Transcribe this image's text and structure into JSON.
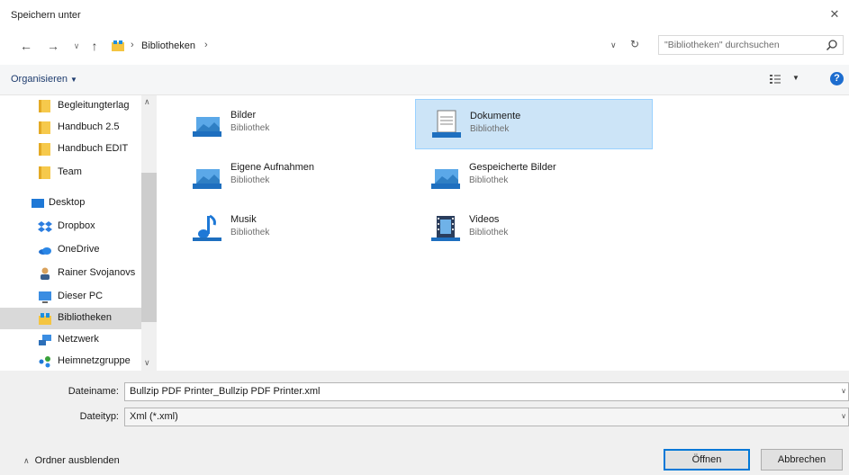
{
  "window": {
    "title": "Speichern unter"
  },
  "nav": {
    "back_icon": "back-arrow-icon",
    "forward_icon": "forward-arrow-icon",
    "up_icon": "up-arrow-icon",
    "address_segment": "Bibliotheken",
    "search_placeholder": "\"Bibliotheken\" durchsuchen"
  },
  "toolbar": {
    "organize_label": "Organisieren"
  },
  "sidebar": {
    "items": [
      {
        "label": "Begleitungterlag",
        "icon": "folder-icon"
      },
      {
        "label": "Handbuch 2.5",
        "icon": "folder-icon"
      },
      {
        "label": "Handbuch EDIT",
        "icon": "folder-icon"
      },
      {
        "label": "Team",
        "icon": "folder-icon"
      },
      {
        "label": "Desktop",
        "icon": "desktop-icon"
      },
      {
        "label": "Dropbox",
        "icon": "dropbox-icon"
      },
      {
        "label": "OneDrive",
        "icon": "onedrive-icon"
      },
      {
        "label": "Rainer Svojanovs",
        "icon": "user-icon"
      },
      {
        "label": "Dieser PC",
        "icon": "computer-icon"
      },
      {
        "label": "Bibliotheken",
        "icon": "libraries-icon",
        "selected": true
      },
      {
        "label": "Netzwerk",
        "icon": "network-icon"
      },
      {
        "label": "Heimnetzgruppe",
        "icon": "homegroup-icon"
      }
    ]
  },
  "libraries": [
    {
      "name": "Bilder",
      "type": "Bibliothek",
      "icon": "pictures-library-icon"
    },
    {
      "name": "Dokumente",
      "type": "Bibliothek",
      "icon": "documents-library-icon",
      "selected": true
    },
    {
      "name": "Eigene Aufnahmen",
      "type": "Bibliothek",
      "icon": "pictures-library-icon"
    },
    {
      "name": "Gespeicherte Bilder",
      "type": "Bibliothek",
      "icon": "pictures-library-icon"
    },
    {
      "name": "Musik",
      "type": "Bibliothek",
      "icon": "music-library-icon"
    },
    {
      "name": "Videos",
      "type": "Bibliothek",
      "icon": "videos-library-icon"
    }
  ],
  "form": {
    "filename_label": "Dateiname:",
    "filename_value": "Bullzip PDF Printer_Bullzip PDF Printer.xml",
    "filetype_label": "Dateityp:",
    "filetype_value": "Xml (*.xml)"
  },
  "footer": {
    "hide_folders_label": "Ordner ausblenden",
    "open_button": "Öffnen",
    "cancel_button": "Abbrechen"
  },
  "colors": {
    "accent": "#0078d7",
    "selection": "#cce4f7",
    "help": "#1d6dcf"
  }
}
